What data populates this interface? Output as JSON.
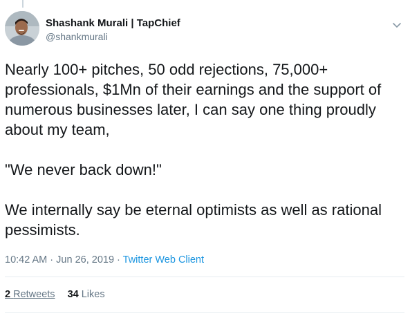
{
  "author": {
    "name": "Shashank Murali | TapChief",
    "handle": "@shankmurali"
  },
  "tweet": {
    "paragraph_1": "Nearly 100+ pitches, 50 odd rejections, 75,000+ professionals, $1Mn of their earnings and the support of numerous businesses later, I can say one thing proudly about my team,",
    "paragraph_2": "\"We never back down!\"",
    "paragraph_3": "We internally say be eternal optimists as well as rational pessimists."
  },
  "meta": {
    "time": "10:42 AM",
    "separator_1": " · ",
    "date": "Jun 26, 2019",
    "separator_2": " · ",
    "client": "Twitter Web Client"
  },
  "stats": {
    "retweets_count": "2",
    "retweets_label": "Retweets",
    "likes_count": "34",
    "likes_label": "Likes"
  },
  "icons": {
    "menu": "chevron-down-icon"
  },
  "colors": {
    "text": "#14171a",
    "secondary": "#657786",
    "link": "#1b95e0",
    "divider": "#e6ecf0"
  }
}
